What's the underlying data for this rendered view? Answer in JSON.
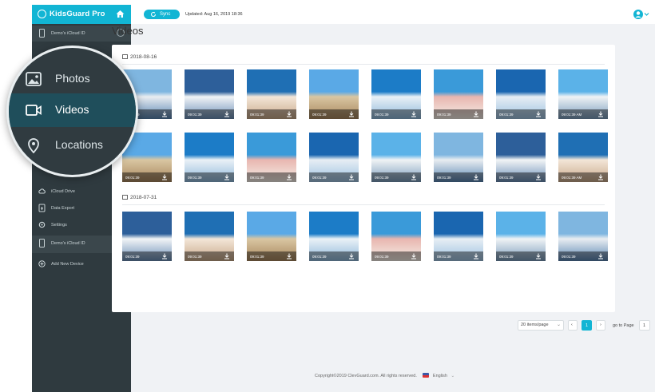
{
  "app": {
    "brand": "KidsGuard Pro"
  },
  "sidebar": {
    "device_label": "Demo's iCloud ID",
    "items": [
      {
        "label": "iCloud Drive",
        "icon": "cloud-icon"
      },
      {
        "label": "Data Export",
        "icon": "export-icon"
      },
      {
        "label": "Settings",
        "icon": "gear-icon"
      }
    ],
    "device_label_2": "Demo's iCloud ID",
    "add_device": "Add New Device"
  },
  "magnifier": {
    "items": [
      {
        "label": "Photos",
        "icon": "photo-icon"
      },
      {
        "label": "Videos",
        "icon": "video-icon",
        "active": true
      },
      {
        "label": "Locations",
        "icon": "location-pin-icon"
      }
    ]
  },
  "topbar": {
    "sync_label": "Sync",
    "updated": "Updated: Aug 16, 2019 18:36"
  },
  "page": {
    "title": "Videos"
  },
  "groups": [
    {
      "date": "2018-08-16",
      "rows": [
        [
          "09:01:39",
          "09:01:39",
          "09:01:39",
          "09:01:39",
          "09:01:39",
          "09:01:39",
          "09:01:39",
          "09:01:39 AM"
        ],
        [
          "09:01:39",
          "09:01:39",
          "09:01:39",
          "09:01:39",
          "09:01:39",
          "09:01:39",
          "09:01:39",
          "09:01:39 AM"
        ]
      ]
    },
    {
      "date": "2018-07-31",
      "rows": [
        [
          "09:01:39",
          "09:01:39",
          "09:01:39",
          "09:01:39",
          "09:01:39",
          "09:01:39",
          "09:01:39",
          "09:01:39"
        ]
      ]
    }
  ],
  "pagination": {
    "per_page": "20 items/page",
    "current_page": "1",
    "goto_label": "go to Page",
    "goto_value": "1"
  },
  "footer": {
    "copyright": "Copyright©2019 ClevGuard.com. All rights reserved.",
    "language": "English"
  },
  "colors": {
    "accent": "#12b5d4",
    "sidebar": "#2f3a3f",
    "background": "#f0f2f5"
  }
}
